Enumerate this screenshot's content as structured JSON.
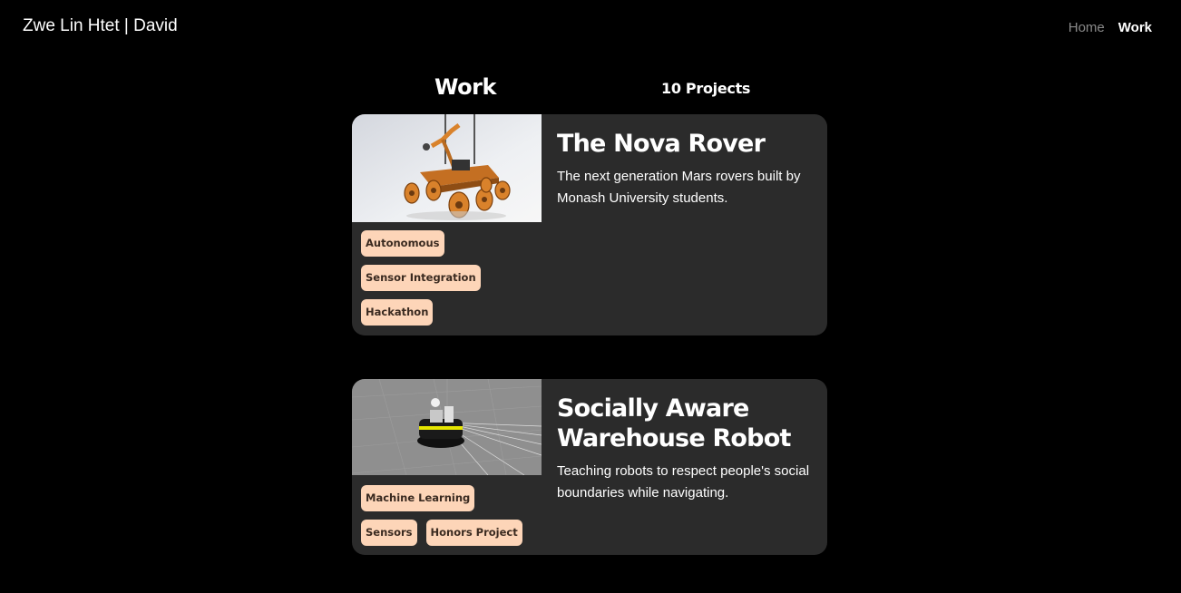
{
  "header": {
    "site_title": "Zwe Lin Htet | David",
    "nav": {
      "home_label": "Home",
      "work_label": "Work"
    }
  },
  "main": {
    "title": "Work",
    "project_count": "10 Projects",
    "projects": [
      {
        "title": "The Nova Rover",
        "description": "The next generation Mars rovers built by Monash University students.",
        "tags": [
          "Autonomous",
          "Sensor Integration",
          "Hackathon"
        ]
      },
      {
        "title": "Socially Aware Warehouse Robot",
        "description": "Teaching robots to respect people's social boundaries while navigating.",
        "tags": [
          "Machine Learning",
          "Sensors",
          "Honors Project"
        ]
      }
    ]
  },
  "colors": {
    "background": "#000000",
    "card_background": "#2b2b2b",
    "tag_background": "#fdd5b8",
    "nav_inactive": "#8a8a8a",
    "rover_orange": "#d9822b"
  }
}
